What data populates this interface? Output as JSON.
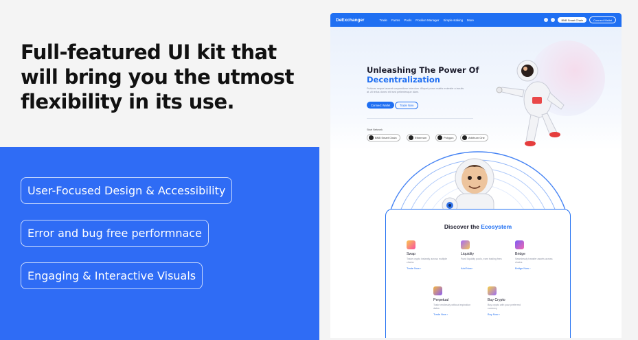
{
  "left": {
    "headline": "Full-featured UI kit that will bring you the utmost flexibility in its use.",
    "features": [
      "User-Focused Design & Accessibility",
      "Error and bug free performnace",
      "Engaging & Interactive Visuals"
    ]
  },
  "nav": {
    "brand": "DeExchanger",
    "items": [
      "Trade",
      "Farms",
      "Pools",
      "Position Manager",
      "Simple staking",
      "More"
    ],
    "chain": "BNB Smart Chain",
    "connect": "Connect Wallet"
  },
  "hero": {
    "title_line1": "Unleashing The Power Of",
    "title_line2": "Decentralization",
    "description": "Pulvinar neque laoreet suspendisse interdum. Aliquet purus mattis molestie a iaculis at. At tellus donec elit sed pellentesque diam.",
    "primary_button": "Connect Wallet",
    "secondary_button": "Trade Now",
    "network_label": "Start Network",
    "networks": [
      "BNB Smart Chain",
      "Ethereum",
      "Polygon",
      "Arbitrum One"
    ]
  },
  "ecosystem": {
    "title_plain": "Discover the ",
    "title_accent": "Ecosystem",
    "cards": [
      {
        "title": "Swap",
        "desc": "Trade crypto instantly across multiple chains",
        "link": "Trade Now  ›"
      },
      {
        "title": "Liquidity",
        "desc": "Fund liquidity pools, earn trading fees",
        "link": "Add Now  ›"
      },
      {
        "title": "Bridge",
        "desc": "Seamlessly transfer assets across chains",
        "link": "Bridge Now  ›"
      },
      {
        "title": "Perpetual",
        "desc": "Trade endlessly without expiration dates",
        "link": "Trade Now  ›"
      },
      {
        "title": "Buy Crypto",
        "desc": "Buy crypto with your preferred currency",
        "link": "Buy Now  ›"
      }
    ]
  },
  "colors": {
    "brand_blue": "#2f6cf5",
    "accent": "#1f6ff2"
  }
}
